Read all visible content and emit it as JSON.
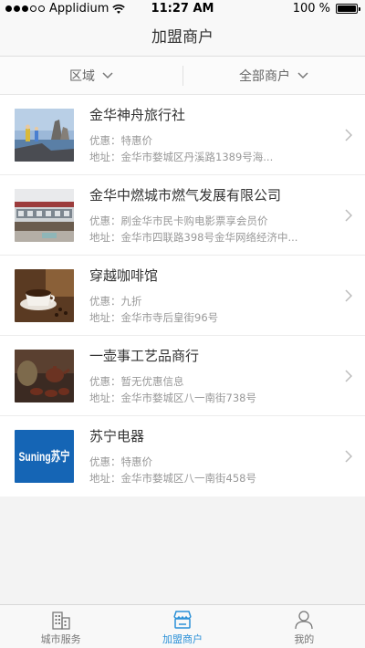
{
  "status_bar": {
    "carrier": "Applidium",
    "time": "11:27 AM",
    "battery": "100 %",
    "battery_level": 1.0
  },
  "nav": {
    "title": "加盟商户"
  },
  "filters": [
    {
      "label": "区域",
      "icon": "chevron-down-icon"
    },
    {
      "label": "全部商户",
      "icon": "chevron-down-icon"
    }
  ],
  "merchants": [
    {
      "name": "金华神舟旅行社",
      "discount": "优惠：特惠价",
      "address": "地址：金华市婺城区丹溪路1389号海..."
    },
    {
      "name": "金华中燃城市燃气发展有限公司",
      "discount": "优惠：刷金华市民卡购电影票享会员价",
      "address": "地址：金华市四联路398号金华网络经济中..."
    },
    {
      "name": "穿越咖啡馆",
      "discount": "优惠：九折",
      "address": "地址：金华市寺后皇街96号"
    },
    {
      "name": "一壶事工艺品商行",
      "discount": "优惠：暂无优惠信息",
      "address": "地址：金华市婺城区八一南街738号"
    },
    {
      "name": "苏宁电器",
      "discount": "优惠：特惠价",
      "address": "地址：金华市婺城区八一南街458号",
      "logo_text": "Suning苏宁"
    }
  ],
  "tabs": [
    {
      "label": "城市服务",
      "icon": "city-building-icon",
      "active": false
    },
    {
      "label": "加盟商户",
      "icon": "storefront-icon",
      "active": true
    },
    {
      "label": "我的",
      "icon": "person-icon",
      "active": false
    }
  ],
  "colors": {
    "accent": "#2a90d7",
    "suning_blue": "#1565b5"
  }
}
